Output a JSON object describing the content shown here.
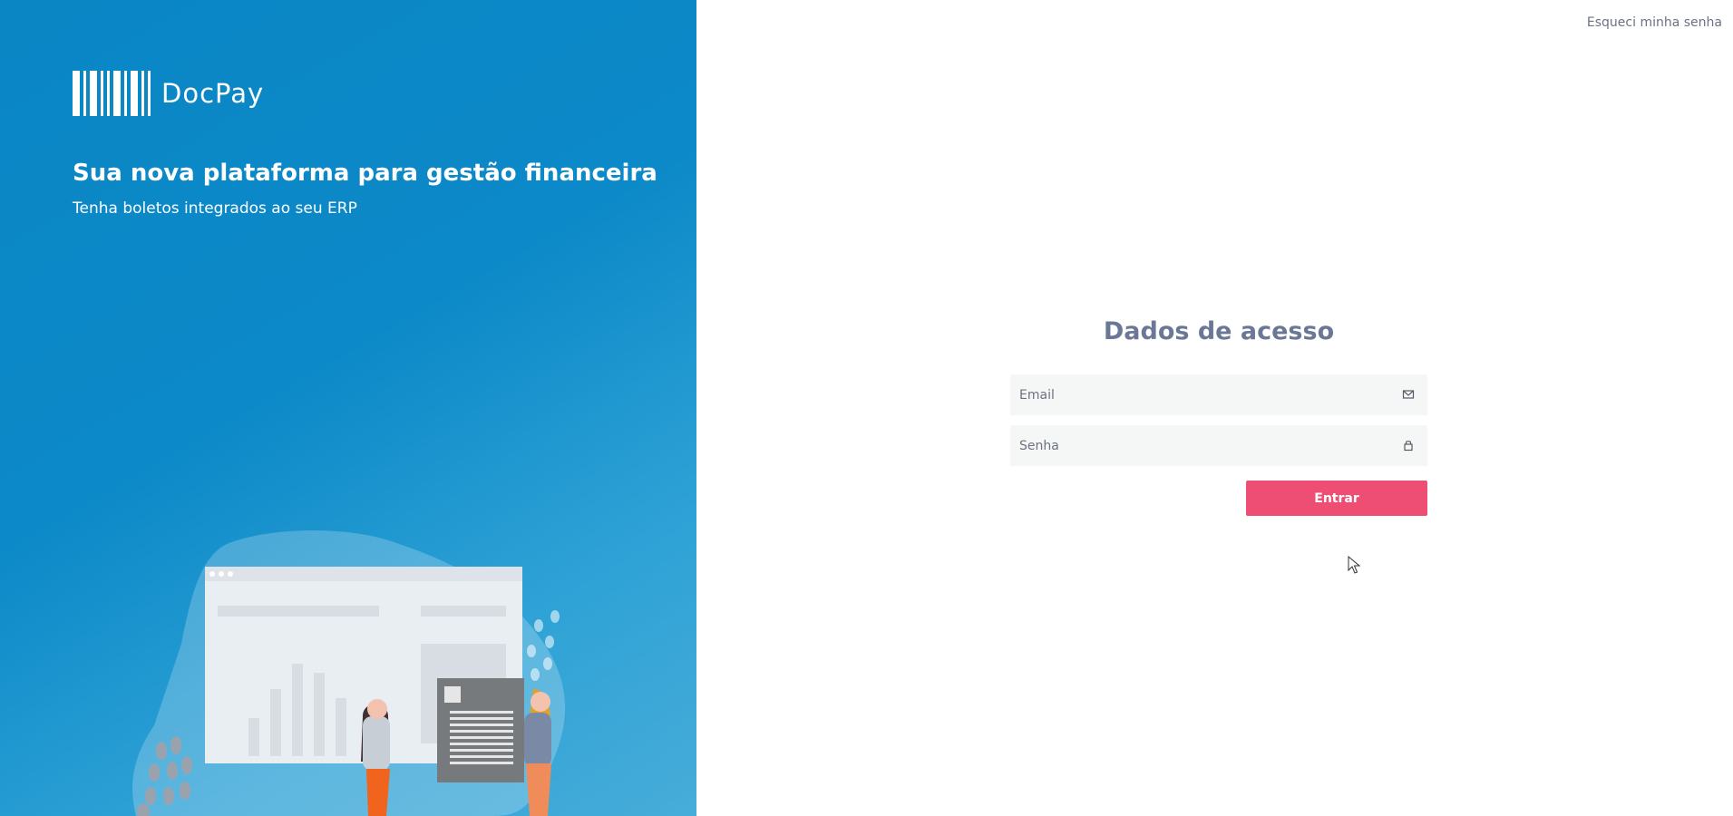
{
  "brand": {
    "name": "DocPay",
    "headline": "Sua nova plataforma para gestão financeira",
    "subheadline": "Tenha boletos integrados ao seu ERP"
  },
  "header": {
    "forgot_password_link": "Esqueci minha senha"
  },
  "login_form": {
    "title": "Dados de acesso",
    "email": {
      "value": "",
      "placeholder": "Email",
      "icon": "envelope-icon"
    },
    "password": {
      "value": "",
      "placeholder": "Senha",
      "icon": "lock-icon"
    },
    "submit_label": "Entrar"
  },
  "colors": {
    "brand_blue": "#0a86c5",
    "accent_pink": "#ee4d74",
    "title_text": "#6b7895",
    "input_background": "#f5f6f6"
  }
}
